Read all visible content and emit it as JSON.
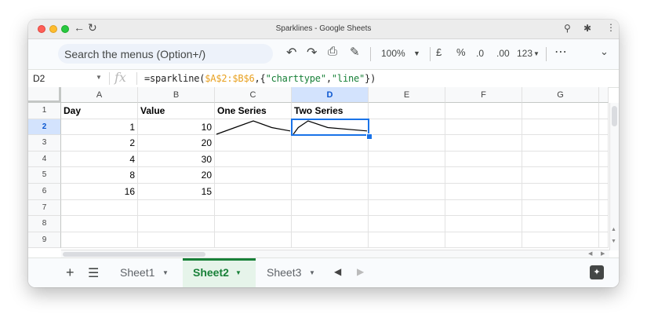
{
  "window": {
    "title": "Sparklines - Google Sheets"
  },
  "toolbar": {
    "search_placeholder": "Search the menus (Option+/)",
    "zoom": "100%",
    "currency": "£",
    "percent": "%",
    "decrease_decimal": ".0",
    "increase_decimal": ".00",
    "number_format": "123"
  },
  "formula_bar": {
    "cell_ref": "D2",
    "fx": "fx",
    "formula_prefix": "=sparkline(",
    "formula_range": "$A$2:$B$6",
    "formula_sep1": ",{",
    "formula_str1": "\"charttype\"",
    "formula_sep2": ",",
    "formula_str2": "\"line\"",
    "formula_suffix": "})"
  },
  "grid": {
    "columns": [
      "A",
      "B",
      "C",
      "D",
      "E",
      "F",
      "G"
    ],
    "selected_column": "D",
    "rows": [
      "1",
      "2",
      "3",
      "4",
      "5",
      "6",
      "7",
      "8",
      "9"
    ],
    "selected_row": "2",
    "header_row": [
      "Day",
      "Value",
      "One Series",
      "Two Series"
    ],
    "data": [
      {
        "day": "1",
        "value": "10"
      },
      {
        "day": "2",
        "value": "20"
      },
      {
        "day": "4",
        "value": "30"
      },
      {
        "day": "8",
        "value": "20"
      },
      {
        "day": "16",
        "value": "15"
      }
    ],
    "selected_cell": "D2"
  },
  "sparklines": {
    "one_series": {
      "type": "line",
      "values": [
        10,
        20,
        30,
        20,
        15
      ]
    },
    "two_series": {
      "type": "line",
      "x": [
        1,
        2,
        4,
        8,
        16
      ],
      "y": [
        10,
        20,
        30,
        20,
        15
      ]
    }
  },
  "sheets": {
    "tabs": [
      "Sheet1",
      "Sheet2",
      "Sheet3"
    ],
    "active": "Sheet2"
  },
  "colors": {
    "accent_green": "#188038",
    "selection_blue": "#1a73e8",
    "formula_ref": "#e8a01e"
  }
}
